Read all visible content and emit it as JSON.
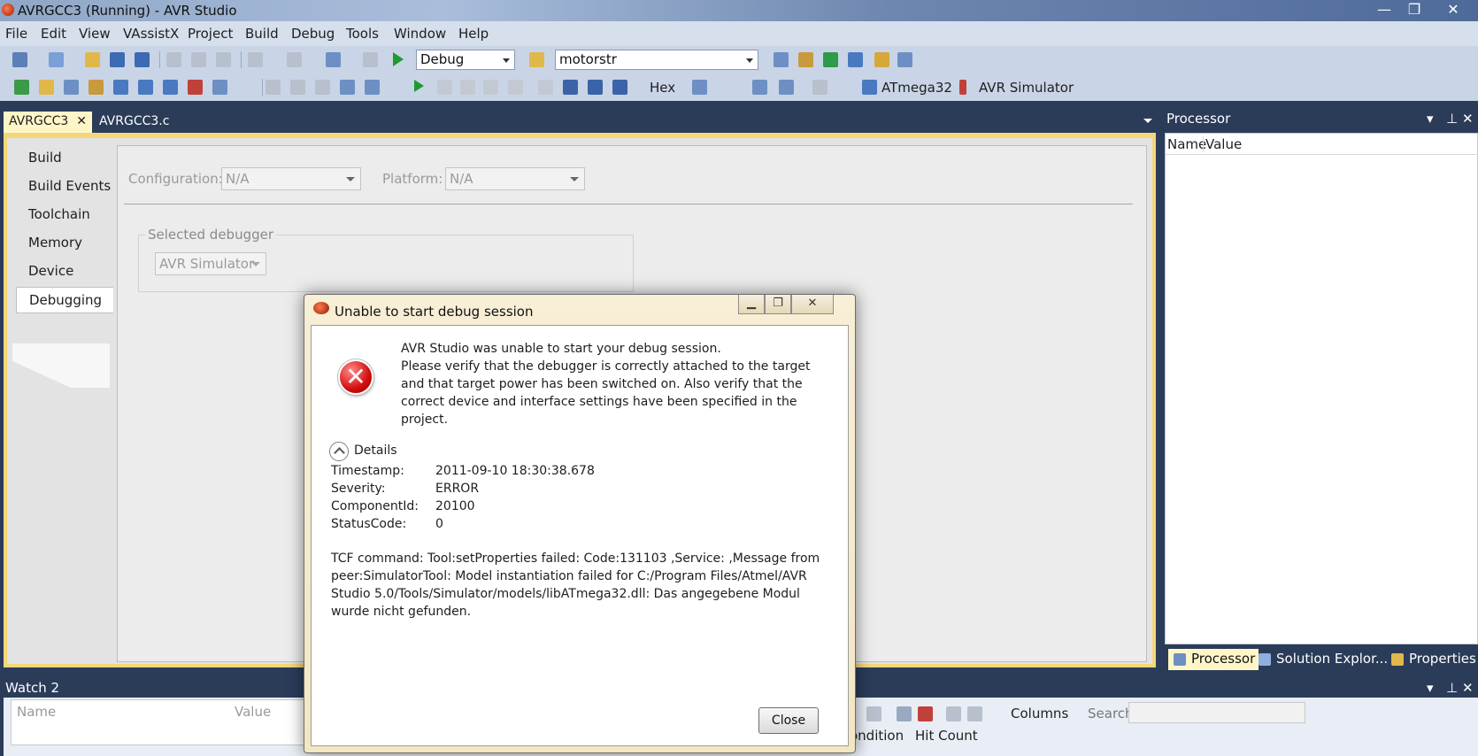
{
  "window": {
    "title": "AVRGCC3 (Running) - AVR Studio",
    "minimize": "—",
    "maximize": "❐",
    "close": "✕"
  },
  "menu": [
    "File",
    "Edit",
    "View",
    "VAssistX",
    "Project",
    "Build",
    "Debug",
    "Tools",
    "Window",
    "Help"
  ],
  "toolbar": {
    "config_value": "Debug",
    "find_value": "motorstr",
    "hex_label": "Hex",
    "device_label": "ATmega32",
    "tool_label": "AVR Simulator"
  },
  "doc_tabs": {
    "active": "AVRGCC3",
    "active_close": "✕",
    "other": "AVRGCC3.c"
  },
  "project_props": {
    "tabs": [
      "Build",
      "Build Events",
      "Toolchain",
      "Memory",
      "Device",
      "Debugging"
    ],
    "active_tab": "Debugging",
    "configuration_label": "Configuration:",
    "configuration_value": "N/A",
    "platform_label": "Platform:",
    "platform_value": "N/A",
    "debugger_group": "Selected debugger",
    "debugger_value": "AVR Simulator"
  },
  "processor_panel": {
    "title": "Processor",
    "columns": [
      "Name",
      "Value"
    ],
    "tabs": [
      "Processor",
      "Solution Explor...",
      "Properties"
    ]
  },
  "watch_panel": {
    "title": "Watch 2",
    "columns": [
      "Name",
      "Value"
    ],
    "columns_button": "Columns",
    "search_label": "Search:",
    "bp_columns": [
      "ondition",
      "Hit Count"
    ]
  },
  "dialog": {
    "title": "Unable to start debug session",
    "message_line1": "AVR Studio was unable to start your debug session.",
    "message_line2": "Please verify that the debugger is correctly attached to the target and that target power has been switched on. Also verify that the correct device and interface settings have been specified in the project.",
    "details_label": "Details",
    "details": [
      {
        "key": "Timestamp:",
        "value": "2011-09-10 18:30:38.678"
      },
      {
        "key": "Severity:",
        "value": "ERROR"
      },
      {
        "key": "ComponentId:",
        "value": "20100"
      },
      {
        "key": "StatusCode:",
        "value": "0"
      }
    ],
    "tcf_message": "TCF command: Tool:setProperties failed:  Code:131103 ,Service: ,Message from peer:SimulatorTool: Model instantiation failed for C:/Program Files/Atmel/AVR Studio 5.0/Tools/Simulator/models/libATmega32.dll: Das angegebene Modul wurde nicht gefunden.",
    "close_button": "Close"
  }
}
